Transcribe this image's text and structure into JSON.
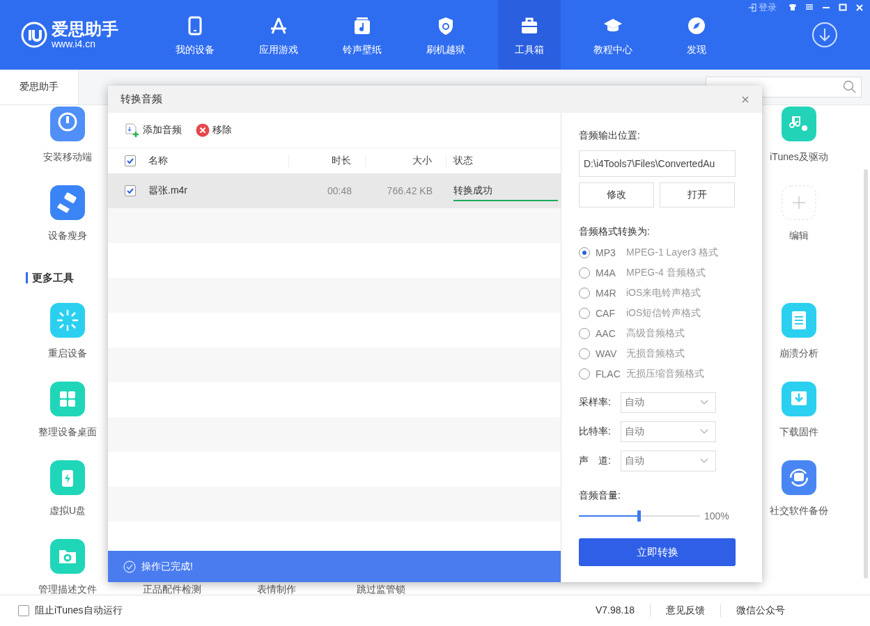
{
  "app": {
    "logo_name": "爱思助手",
    "logo_url": "www.i4.cn",
    "login": "登录"
  },
  "nav": [
    {
      "label": "我的设备",
      "kind": "phone",
      "selected": false
    },
    {
      "label": "应用游戏",
      "kind": "appstore",
      "selected": false
    },
    {
      "label": "铃声壁纸",
      "kind": "music",
      "selected": false
    },
    {
      "label": "刷机越狱",
      "kind": "shield",
      "selected": false
    },
    {
      "label": "工具箱",
      "kind": "toolbox",
      "selected": true
    },
    {
      "label": "教程中心",
      "kind": "cap",
      "selected": false
    },
    {
      "label": "发现",
      "kind": "compass",
      "selected": false
    }
  ],
  "tabs": [
    {
      "label": "爱思助手",
      "selected": true
    }
  ],
  "tool_rows": [
    {
      "left": {
        "label": "安装移动端",
        "kind": "install"
      },
      "right": {
        "label": "iTunes及驱动",
        "kind": "itunes"
      }
    },
    {
      "left": {
        "label": "设备瘦身",
        "kind": "clean"
      },
      "right": {
        "label": "编辑",
        "kind": "add"
      }
    }
  ],
  "more_tools": {
    "title": "更多工具",
    "rows": [
      {
        "left": {
          "label": "重启设备",
          "kind": "restart"
        },
        "right": {
          "label": "崩溃分析",
          "kind": "crash"
        }
      },
      {
        "left": {
          "label": "整理设备桌面",
          "kind": "grid"
        },
        "right": {
          "label": "下载固件",
          "kind": "download"
        }
      },
      {
        "left": {
          "label": "虚拟U盘",
          "kind": "udisk"
        },
        "right": {
          "label": "社交软件备份",
          "kind": "backup"
        }
      },
      {
        "left": {
          "label": "管理描述文件",
          "kind": "profile"
        },
        "middle": [
          "正品配件检测",
          "表情制作",
          "跳过监管锁"
        ]
      }
    ]
  },
  "status_bar": {
    "checkbox": {
      "label": "阻止iTunes自动运行",
      "checked": false
    },
    "links": [
      "V7.98.18",
      "意见反馈",
      "微信公众号"
    ]
  },
  "dialog": {
    "title": "转换音频",
    "toolbar": [
      "添加音频",
      "移除"
    ],
    "columns": [
      "名称",
      "时长",
      "大小",
      "状态"
    ],
    "all_checked": true,
    "rows": [
      {
        "checked": true,
        "selected": true,
        "name": "嚣张.m4r",
        "duration": "00:48",
        "size": "766.42 KB",
        "status": "转换成功",
        "level": 1
      }
    ],
    "footer": "操作已完成!",
    "output_label": "音频输出位置:",
    "output_path": "D:\\i4Tools7\\Files\\ConvertedAu",
    "path_buttons": [
      "修改",
      "打开"
    ],
    "format_label": "音频格式转换为:",
    "formats": [
      {
        "code": "MP3",
        "description": "MPEG-1 Layer3 格式",
        "selected": true
      },
      {
        "code": "M4A",
        "description": "MPEG-4 音频格式",
        "selected": false
      },
      {
        "code": "M4R",
        "description": "iOS来电铃声格式",
        "selected": false
      },
      {
        "code": "CAF",
        "description": "iOS短信铃声格式",
        "selected": false
      },
      {
        "code": "AAC",
        "description": "高级音频格式",
        "selected": false
      },
      {
        "code": "WAV",
        "description": "无损音频格式",
        "selected": false
      },
      {
        "code": "FLAC",
        "description": "无损压缩音频格式",
        "selected": false
      }
    ],
    "selects": [
      {
        "label": "采样率:",
        "value": "自动"
      },
      {
        "label": "比特率:",
        "value": "自动"
      },
      {
        "label": "声　道:",
        "value": "自动"
      }
    ],
    "volume": {
      "label": "音频音量:",
      "level": 0.5,
      "reading": "100%"
    },
    "convert_button": "立即转换"
  }
}
